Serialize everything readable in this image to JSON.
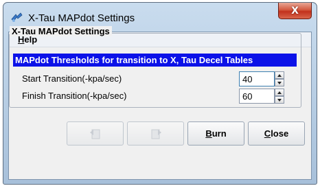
{
  "window": {
    "title": "X-Tau MAPdot Settings",
    "close_glyph": "X"
  },
  "menubar": {
    "help": {
      "mnemonic": "H",
      "rest": "elp"
    }
  },
  "group": {
    "title": "X-Tau MAPdot Settings",
    "header": "MAPdot Thresholds for transition to X, Tau Decel Tables",
    "fields": [
      {
        "label": "Start Transition(-kpa/sec)",
        "value": "40"
      },
      {
        "label": "Finish Transition(-kpa/sec)",
        "value": "60"
      }
    ]
  },
  "buttons": {
    "undo_icon": "undo-icon",
    "redo_icon": "redo-icon",
    "burn": {
      "mnemonic": "B",
      "rest": "urn"
    },
    "close": {
      "mnemonic": "C",
      "rest": "lose"
    }
  },
  "colors": {
    "highlight": "#0c12e8",
    "close_button": "#c2311c"
  }
}
